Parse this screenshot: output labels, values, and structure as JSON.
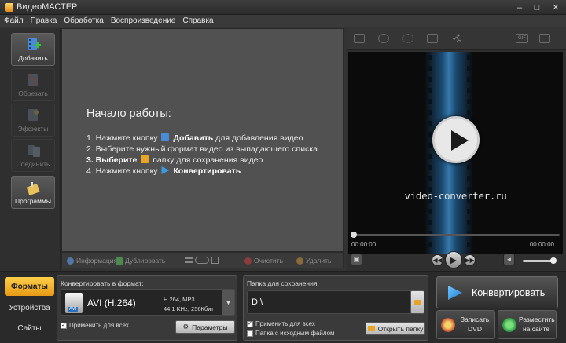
{
  "window": {
    "title": "ВидеоМАСТЕР",
    "controls": [
      "–",
      "□",
      "✕"
    ]
  },
  "menu": [
    "Файл",
    "Правка",
    "Обработка",
    "Воспроизведение",
    "Справка"
  ],
  "tools": [
    {
      "label": "Добавить",
      "icon": "film-add-icon",
      "enabled": true
    },
    {
      "label": "Обрезать",
      "icon": "cut-film-icon",
      "enabled": false
    },
    {
      "label": "Эффекты",
      "icon": "effects-icon",
      "enabled": false
    },
    {
      "label": "Соединить",
      "icon": "join-icon",
      "enabled": false
    },
    {
      "label": "Программы",
      "icon": "programs-icon",
      "enabled": true
    }
  ],
  "workspace": {
    "heading": "Начало работы:",
    "steps": [
      {
        "pre": "1. Нажмите кнопку",
        "bold": "Добавить",
        "post": "для добавления видео"
      },
      {
        "pre": "2. Выберите нужный формат видео из выпадающего списка",
        "bold": "",
        "post": ""
      },
      {
        "pre": "",
        "bold": "3. Выберите",
        "post": "папку для сохранения видео"
      },
      {
        "pre": "4. Нажмите кнопку",
        "bold": "Конвертировать",
        "post": ""
      }
    ]
  },
  "workspace_bar": {
    "info": "Информация",
    "duplicate": "Дублировать",
    "clear": "Очистить",
    "delete": "Удалить"
  },
  "preview": {
    "url": "video-converter.ru",
    "time_start": "00:00:00",
    "time_end": "00:00:00",
    "progress": 0,
    "volume": 1.0,
    "top_icons": [
      "crop-icon",
      "photo-icon",
      "brightness-icon",
      "film-icon",
      "speed-icon",
      "gif-icon",
      "fullscreen-icon"
    ],
    "top_icon_labels": {
      "gif": "GIF"
    }
  },
  "bottom_tabs": [
    {
      "label": "Форматы",
      "active": true
    },
    {
      "label": "Устройства",
      "active": false
    },
    {
      "label": "Сайты",
      "active": false
    }
  ],
  "format": {
    "header": "Конвертировать в формат:",
    "name": "AVI (H.264)",
    "badge": "AVI",
    "spec1": "H.264, MP3",
    "spec2": "44,1 KHz, 256Кбит",
    "apply_all": "Применить для всех",
    "apply_all_checked": true,
    "params_button": "Параметры"
  },
  "folder": {
    "header": "Папка для сохранения:",
    "path": "D:\\",
    "apply_all": "Применить для всех",
    "apply_all_checked": true,
    "source_folder": "Папка с исходным файлом",
    "source_folder_checked": false,
    "open_button": "Открыть папку"
  },
  "actions": {
    "convert": "Конвертировать",
    "burn_dvd": "Записать DVD",
    "publish": "Разместить на сайте"
  },
  "colors": {
    "accent": "#f0aa20",
    "screen_glow": "#46aaf0"
  }
}
